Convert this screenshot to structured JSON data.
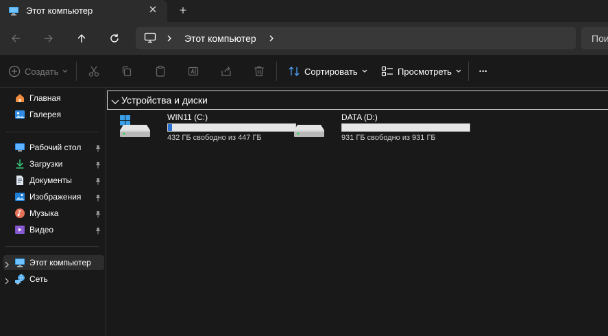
{
  "tab": {
    "title": "Этот компьютер",
    "close_glyph": "✕",
    "new_tab_glyph": "+"
  },
  "address": {
    "location": "Этот компьютер"
  },
  "search": {
    "placeholder_text": "Пои"
  },
  "commands": {
    "create": "Создать",
    "sort": "Сортировать",
    "view": "Просмотреть",
    "more_glyph": "•••"
  },
  "sidebar": {
    "quick": [
      {
        "label": "Главная",
        "icon": "home-icon"
      },
      {
        "label": "Галерея",
        "icon": "gallery-icon"
      }
    ],
    "pinned": [
      {
        "label": "Рабочий стол",
        "icon": "desktop-folder-icon"
      },
      {
        "label": "Загрузки",
        "icon": "downloads-icon"
      },
      {
        "label": "Документы",
        "icon": "documents-icon"
      },
      {
        "label": "Изображения",
        "icon": "pictures-icon"
      },
      {
        "label": "Музыка",
        "icon": "music-icon"
      },
      {
        "label": "Видео",
        "icon": "video-icon"
      }
    ],
    "locations": [
      {
        "label": "Этот компьютер",
        "icon": "this-pc-icon",
        "selected": true
      },
      {
        "label": "Сеть",
        "icon": "network-icon",
        "selected": false
      }
    ]
  },
  "content": {
    "group_title": "Устройства и диски",
    "drives": [
      {
        "name": "WIN11 (C:)",
        "free_text": "432 ГБ свободно из 447 ГБ",
        "used_fraction": 0.034,
        "system": true
      },
      {
        "name": "DATA (D:)",
        "free_text": "931 ГБ свободно из 931 ГБ",
        "used_fraction": 0.0,
        "system": false
      }
    ]
  },
  "colors": {
    "accent": "#2a6fd1",
    "bg": "#191919",
    "chrome": "#2c2c2c"
  }
}
